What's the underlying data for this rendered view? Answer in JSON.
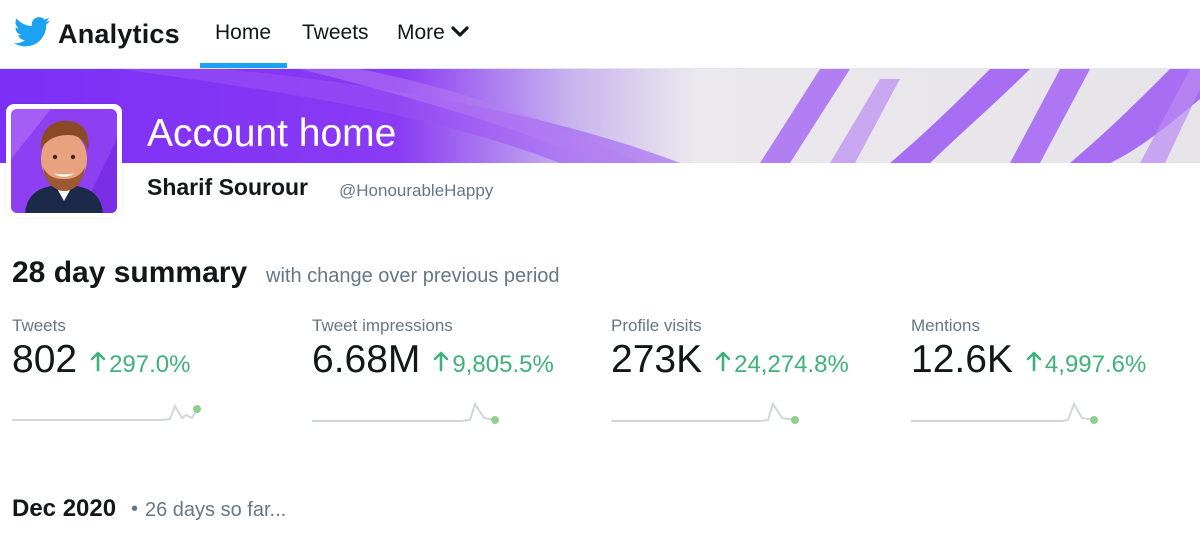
{
  "nav": {
    "brand": "Analytics",
    "items": [
      {
        "label": "Home",
        "active": true
      },
      {
        "label": "Tweets",
        "active": false
      },
      {
        "label": "More",
        "active": false
      }
    ],
    "brand_icon": "twitter-bird-icon",
    "more_icon": "chevron-down-icon",
    "accent_color": "#1da1f2"
  },
  "header": {
    "title": "Account home",
    "banner_colors": [
      "#7b2ff7",
      "#a85cf0",
      "#e8e6ea"
    ]
  },
  "profile": {
    "name": "Sharif Sourour",
    "handle": "@HonourableHappy"
  },
  "summary": {
    "heading": "28 day summary",
    "subheading": "with change over previous period",
    "metrics": [
      {
        "label": "Tweets",
        "value": "802",
        "change": "297.0%",
        "direction": "up"
      },
      {
        "label": "Tweet impressions",
        "value": "6.68M",
        "change": "9,805.5%",
        "direction": "up"
      },
      {
        "label": "Profile visits",
        "value": "273K",
        "change": "24,274.8%",
        "direction": "up"
      },
      {
        "label": "Mentions",
        "value": "12.6K",
        "change": "4,997.6%",
        "direction": "up"
      }
    ],
    "positive_color": "#3eb27a"
  },
  "month": {
    "title": "Dec 2020",
    "separator": "•",
    "subtitle": "26 days so far..."
  }
}
